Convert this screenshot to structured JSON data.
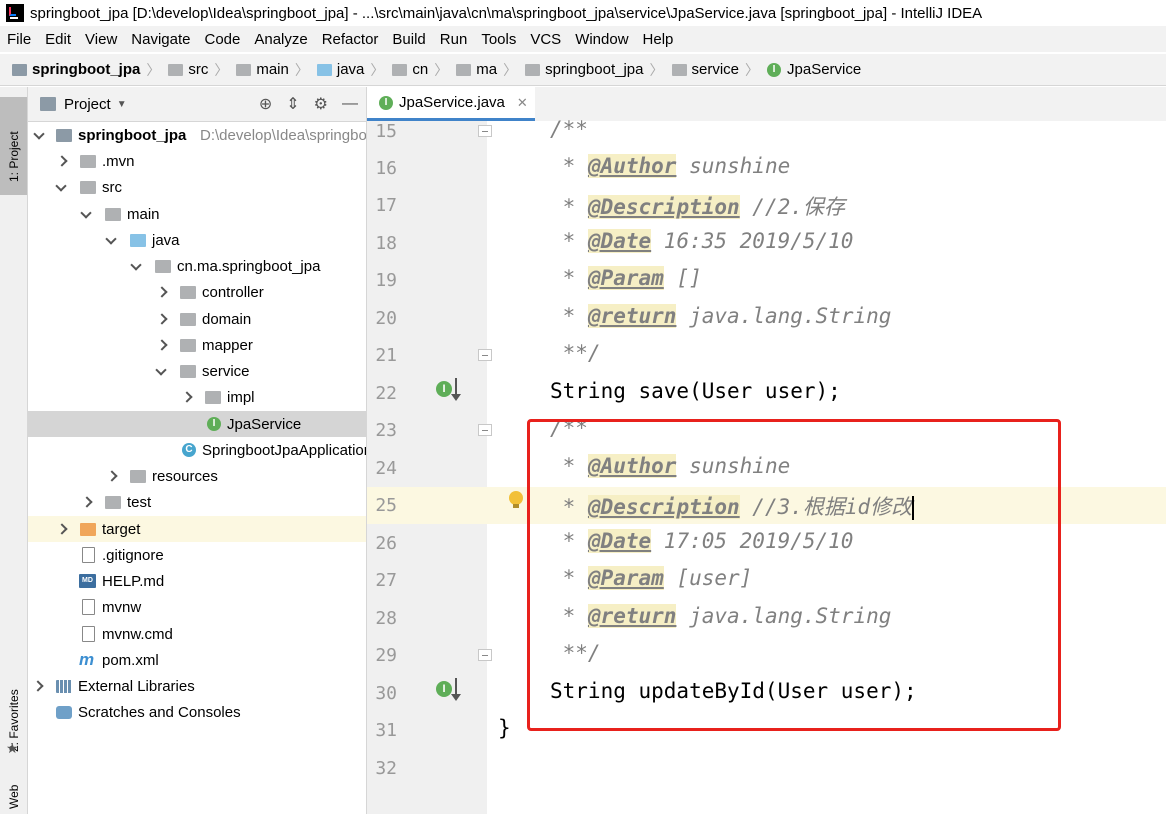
{
  "window": {
    "title": "springboot_jpa [D:\\develop\\Idea\\springboot_jpa] - ...\\src\\main\\java\\cn\\ma\\springboot_jpa\\service\\JpaService.java [springboot_jpa] - IntelliJ IDEA"
  },
  "menu": [
    "File",
    "Edit",
    "View",
    "Navigate",
    "Code",
    "Analyze",
    "Refactor",
    "Build",
    "Run",
    "Tools",
    "VCS",
    "Window",
    "Help"
  ],
  "breadcrumb": [
    "springboot_jpa",
    "src",
    "main",
    "java",
    "cn",
    "ma",
    "springboot_jpa",
    "service",
    "JpaService"
  ],
  "left_strip": {
    "project_tab": "1: Project",
    "favorites_tab": "2: Favorites",
    "web_tab": "Web"
  },
  "project_panel": {
    "title": "Project",
    "tree": [
      {
        "label": "springboot_jpa",
        "path": "D:\\develop\\Idea\\springboot_jpa"
      },
      {
        "label": ".mvn"
      },
      {
        "label": "src"
      },
      {
        "label": "main"
      },
      {
        "label": "java"
      },
      {
        "label": "cn.ma.springboot_jpa"
      },
      {
        "label": "controller"
      },
      {
        "label": "domain"
      },
      {
        "label": "mapper"
      },
      {
        "label": "service"
      },
      {
        "label": "impl"
      },
      {
        "label": "JpaService"
      },
      {
        "label": "SpringbootJpaApplication"
      },
      {
        "label": "resources"
      },
      {
        "label": "test"
      },
      {
        "label": "target"
      },
      {
        "label": ".gitignore"
      },
      {
        "label": "HELP.md"
      },
      {
        "label": "mvnw"
      },
      {
        "label": "mvnw.cmd"
      },
      {
        "label": "pom.xml"
      },
      {
        "label": "External Libraries"
      },
      {
        "label": "Scratches and Consoles"
      }
    ]
  },
  "editor": {
    "tab": "JpaService.java",
    "line_numbers": [
      "15",
      "16",
      "17",
      "18",
      "19",
      "20",
      "21",
      "22",
      "23",
      "24",
      "25",
      "26",
      "27",
      "28",
      "29",
      "30",
      "31",
      "32"
    ],
    "lines": {
      "l15": "/**",
      "l16_tag": "@Author",
      "l16_rest": " sunshine",
      "l17_tag": "@Description",
      "l17_rest": " //2.保存",
      "l18_tag": "@Date",
      "l18_rest": " 16:35 2019/5/10",
      "l19_tag": "@Param",
      "l19_rest": " []",
      "l20_tag": "@return",
      "l20_rest": " java.lang.String",
      "l21": " **/",
      "l22": "String save(User user);",
      "l23": "/**",
      "l24_tag": "@Author",
      "l24_rest": " sunshine",
      "l25_tag": "@Description",
      "l25_rest": " //3.根据id修改",
      "l26_tag": "@Date",
      "l26_rest": " 17:05 2019/5/10",
      "l27_tag": "@Param",
      "l27_rest": " [user]",
      "l28_tag": "@return",
      "l28_rest": " java.lang.String",
      "l29": " **/",
      "l30": "String updateById(User user);",
      "l31": "}",
      "star": " * "
    }
  },
  "colors": {
    "highlight_box": "#e8211c",
    "interface_icon": "#5fae58",
    "current_line": "#fcf8e1"
  }
}
